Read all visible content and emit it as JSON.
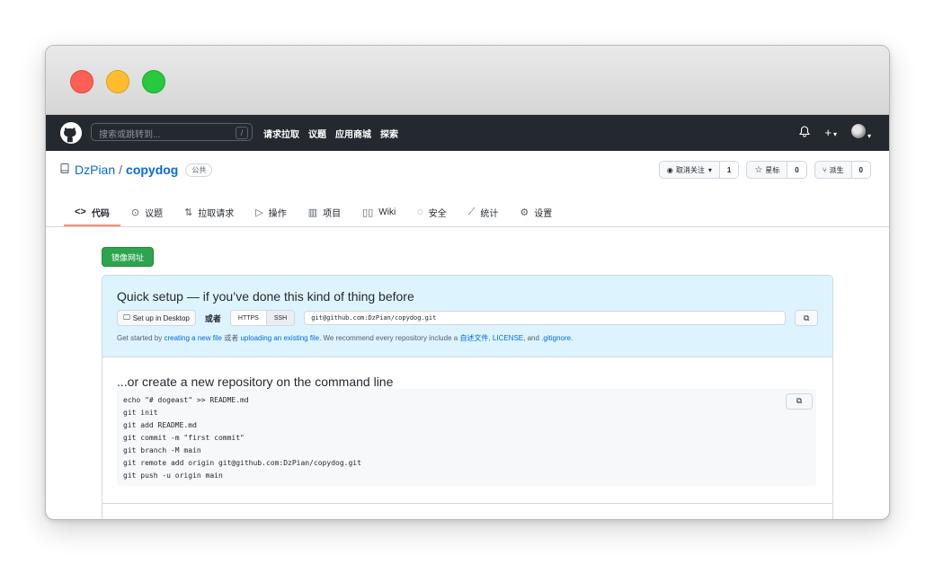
{
  "header": {
    "search_placeholder": "搜索或跳转到...",
    "search_shortcut": "/",
    "nav": [
      "请求拉取",
      "议题",
      "应用商城",
      "探索"
    ],
    "icons": [
      "bell-icon",
      "plus-icon",
      "avatar"
    ]
  },
  "repo": {
    "owner": "DzPian",
    "separator": "/",
    "name": "copydog",
    "visibility": "公共",
    "watch_label": "取消关注",
    "watch_count": "1",
    "star_label": "星标",
    "star_count": "0",
    "fork_label": "派生",
    "fork_count": "0"
  },
  "tabs": [
    {
      "label": "代码",
      "icon": "code-icon"
    },
    {
      "label": "议题",
      "icon": "issues-icon"
    },
    {
      "label": "拉取请求",
      "icon": "pull-request-icon"
    },
    {
      "label": "操作",
      "icon": "actions-icon"
    },
    {
      "label": "项目",
      "icon": "projects-icon"
    },
    {
      "label": "Wiki",
      "icon": "wiki-icon"
    },
    {
      "label": "安全",
      "icon": "security-icon"
    },
    {
      "label": "统计",
      "icon": "insights-icon"
    },
    {
      "label": "设置",
      "icon": "settings-icon"
    }
  ],
  "mirror_button": "镜像网址",
  "quick_setup": {
    "title": "Quick setup — if you’ve done this kind of thing before",
    "desktop_button": "Set up in Desktop",
    "or": "或者",
    "https": "HTTPS",
    "ssh": "SSH",
    "url": "git@github.com:DzPian/copydog.git",
    "hint_prefix": "Get started by",
    "hint_link1": "creating a new file",
    "hint_or": "或者",
    "hint_link2": "uploading an existing file",
    "hint_mid": ". We recommend every repository include a",
    "hint_readme": "自述文件",
    "hint_license": "LICENSE",
    "hint_and": "and",
    "hint_gitignore": ".gitignore",
    "hint_end": "."
  },
  "command_line": {
    "title": "...or create a new repository on the command line",
    "lines": [
      "echo \"# dogeast\" >> README.md",
      "git init",
      "git add README.md",
      "git commit -m \"first commit\"",
      "git branch -M main",
      "git remote add origin git@github.com:DzPian/copydog.git",
      "git push -u origin main"
    ]
  }
}
